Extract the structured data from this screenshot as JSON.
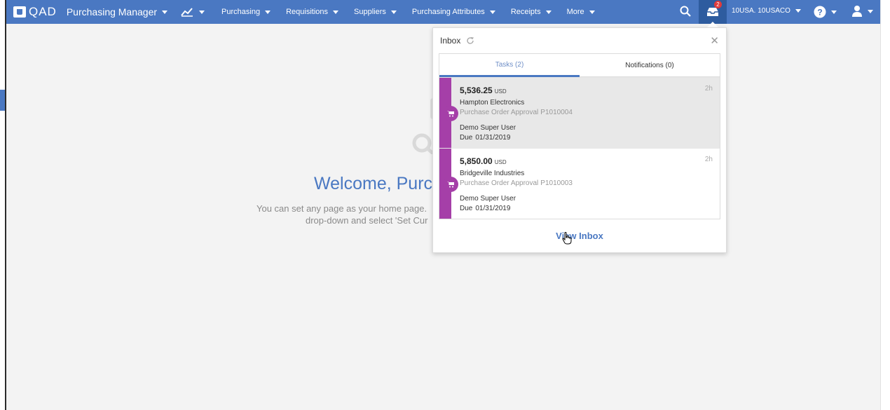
{
  "navbar": {
    "brand": "QAD",
    "app_title": "Purchasing Manager",
    "menus": [
      "Purchasing",
      "Requisitions",
      "Suppliers",
      "Purchasing Attributes",
      "Receipts",
      "More"
    ],
    "inbox_badge": "2",
    "domain_selector": "10USA. 10USACO"
  },
  "welcome": {
    "title": "Welcome, Purc",
    "hint_line1": "You can set any page as your home page.",
    "hint_line2": "drop-down and select 'Set Cur"
  },
  "inbox": {
    "title": "Inbox",
    "tabs": {
      "tasks": "Tasks (2)",
      "notifications": "Notifications (0)"
    },
    "tasks": [
      {
        "amount": "5,536.25",
        "currency": "USD",
        "age": "2h",
        "supplier": "Hampton Electronics",
        "type": "Purchase Order Approval",
        "order": "P1010004",
        "user": "Demo Super User",
        "due_label": "Due",
        "due_date": "01/31/2019"
      },
      {
        "amount": "5,850.00",
        "currency": "USD",
        "age": "2h",
        "supplier": "Bridgeville Industries",
        "type": "Purchase Order Approval",
        "order": "P1010003",
        "user": "Demo Super User",
        "due_label": "Due",
        "due_date": "01/31/2019"
      }
    ],
    "view_inbox": "View Inbox"
  },
  "icons": {
    "close": "close-icon",
    "refresh": "refresh-icon",
    "cart": "cart-icon",
    "search": "search-icon",
    "help": "help-icon",
    "user": "user-icon",
    "chart": "chart-icon",
    "inbox": "inbox-icon"
  },
  "colors": {
    "nav": "#4a78c2",
    "task_stripe": "#a53fa8",
    "selected_task": "#e8e8e8"
  }
}
